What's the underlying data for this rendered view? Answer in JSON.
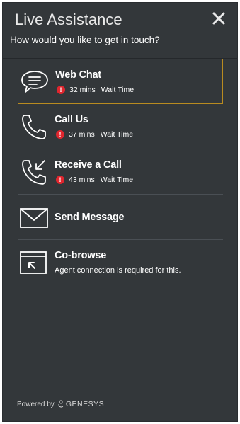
{
  "header": {
    "title": "Live Assistance",
    "subtitle": "How would you like to get in touch?",
    "close_icon": "close-icon"
  },
  "options": [
    {
      "name": "Web Chat",
      "icon": "chat-bubble-icon",
      "wait_mins": "32 mins",
      "wait_label": "Wait Time",
      "selected": true
    },
    {
      "name": "Call Us",
      "icon": "phone-icon",
      "wait_mins": "37 mins",
      "wait_label": "Wait Time"
    },
    {
      "name": "Receive a Call",
      "icon": "phone-incoming-icon",
      "wait_mins": "43 mins",
      "wait_label": "Wait Time"
    },
    {
      "name": "Send Message",
      "icon": "envelope-icon"
    },
    {
      "name": "Co-browse",
      "icon": "cobrowse-icon",
      "description": "Agent connection is required for this."
    }
  ],
  "warning_glyph": "!",
  "footer": {
    "powered_by": "Powered by",
    "brand": "GENESYS"
  },
  "colors": {
    "panel_bg": "#33373a",
    "selected_border": "#b98b20",
    "warning": "#e0262e"
  }
}
